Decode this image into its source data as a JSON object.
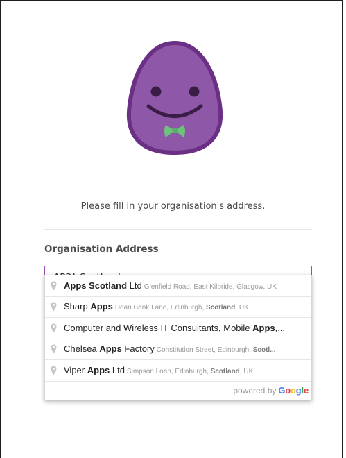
{
  "page": {
    "prompt": "Please fill in your organisation's address.",
    "field_label": "Organisation Address",
    "address_value": "APPA Scotland"
  },
  "icons": {
    "mascot": "purple-blob-mascot-with-bowtie",
    "pin": "location-pin-icon"
  },
  "colors": {
    "accent": "#9c4fb2",
    "mascot_body": "#8e57a8",
    "bowtie": "#6dc27c"
  },
  "suggestions": [
    {
      "main": [
        {
          "t": "Apps Scotland",
          "b": true
        },
        {
          "t": " Ltd",
          "b": false
        }
      ],
      "secondary": [
        {
          "t": "Glenfield Road, East Kilbride, Glasgow, UK",
          "b": false
        }
      ]
    },
    {
      "main": [
        {
          "t": "Sharp ",
          "b": false
        },
        {
          "t": "Apps",
          "b": true
        }
      ],
      "secondary": [
        {
          "t": "Dean Bank Lane, Edinburgh, ",
          "b": false
        },
        {
          "t": "Scotland",
          "b": true
        },
        {
          "t": ", UK",
          "b": false
        }
      ]
    },
    {
      "main": [
        {
          "t": "Computer and Wireless IT Consultants, Mobile ",
          "b": false
        },
        {
          "t": "Apps",
          "b": true
        },
        {
          "t": ",...",
          "b": false
        }
      ],
      "secondary": []
    },
    {
      "main": [
        {
          "t": "Chelsea ",
          "b": false
        },
        {
          "t": "Apps",
          "b": true
        },
        {
          "t": " Factory",
          "b": false
        }
      ],
      "secondary": [
        {
          "t": "Constitution Street, Edinburgh, ",
          "b": false
        },
        {
          "t": "Scotl...",
          "b": true
        }
      ]
    },
    {
      "main": [
        {
          "t": "Viper ",
          "b": false
        },
        {
          "t": "Apps",
          "b": true
        },
        {
          "t": " Ltd",
          "b": false
        }
      ],
      "secondary": [
        {
          "t": "Simpson Loan, Edinburgh, ",
          "b": false
        },
        {
          "t": "Scotland",
          "b": true
        },
        {
          "t": ", UK",
          "b": false
        }
      ]
    }
  ],
  "attribution": {
    "prefix": "powered by",
    "brand": [
      {
        "t": "G",
        "c": "#4285f4"
      },
      {
        "t": "o",
        "c": "#ea4335"
      },
      {
        "t": "o",
        "c": "#fbbc05"
      },
      {
        "t": "g",
        "c": "#4285f4"
      },
      {
        "t": "l",
        "c": "#34a853"
      },
      {
        "t": "e",
        "c": "#ea4335"
      }
    ]
  }
}
